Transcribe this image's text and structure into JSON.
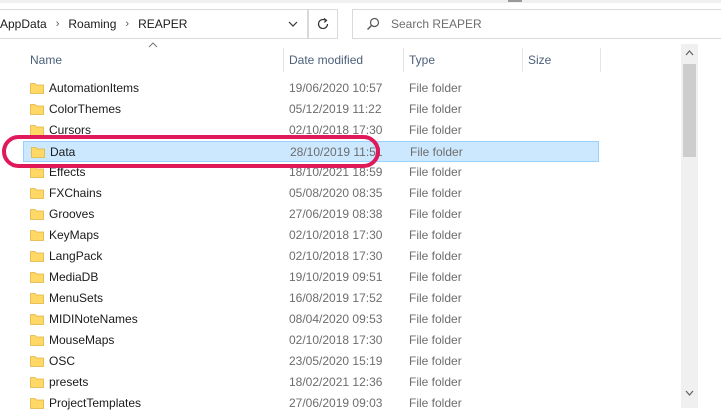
{
  "breadcrumb": {
    "items": [
      "AppData",
      "Roaming",
      "REAPER"
    ]
  },
  "search": {
    "placeholder": "Search REAPER"
  },
  "columns": {
    "name": "Name",
    "date": "Date modified",
    "type": "Type",
    "size": "Size"
  },
  "rows": [
    {
      "name": "AutomationItems",
      "date": "19/06/2020 10:57",
      "type": "File folder"
    },
    {
      "name": "ColorThemes",
      "date": "05/12/2019 11:22",
      "type": "File folder"
    },
    {
      "name": "Cursors",
      "date": "02/10/2018 17:30",
      "type": "File folder"
    },
    {
      "name": "Data",
      "date": "28/10/2019 11:51",
      "type": "File folder",
      "selected": true
    },
    {
      "name": "Effects",
      "date": "18/10/2021 18:59",
      "type": "File folder"
    },
    {
      "name": "FXChains",
      "date": "05/08/2020 08:35",
      "type": "File folder"
    },
    {
      "name": "Grooves",
      "date": "27/06/2019 08:38",
      "type": "File folder"
    },
    {
      "name": "KeyMaps",
      "date": "02/10/2018 17:30",
      "type": "File folder"
    },
    {
      "name": "LangPack",
      "date": "02/10/2018 17:30",
      "type": "File folder"
    },
    {
      "name": "MediaDB",
      "date": "19/10/2019 09:51",
      "type": "File folder"
    },
    {
      "name": "MenuSets",
      "date": "16/08/2019 17:52",
      "type": "File folder"
    },
    {
      "name": "MIDINoteNames",
      "date": "08/04/2020 09:53",
      "type": "File folder"
    },
    {
      "name": "MouseMaps",
      "date": "02/10/2018 17:30",
      "type": "File folder"
    },
    {
      "name": "OSC",
      "date": "23/05/2020 15:19",
      "type": "File folder"
    },
    {
      "name": "presets",
      "date": "18/02/2021 12:36",
      "type": "File folder"
    },
    {
      "name": "ProjectTemplates",
      "date": "27/06/2019 09:03",
      "type": "File folder"
    }
  ],
  "colors": {
    "selection": "#cce8ff",
    "selection_border": "#99d1ff",
    "highlight_ring": "#e0195a",
    "folder": "#ffd866"
  }
}
